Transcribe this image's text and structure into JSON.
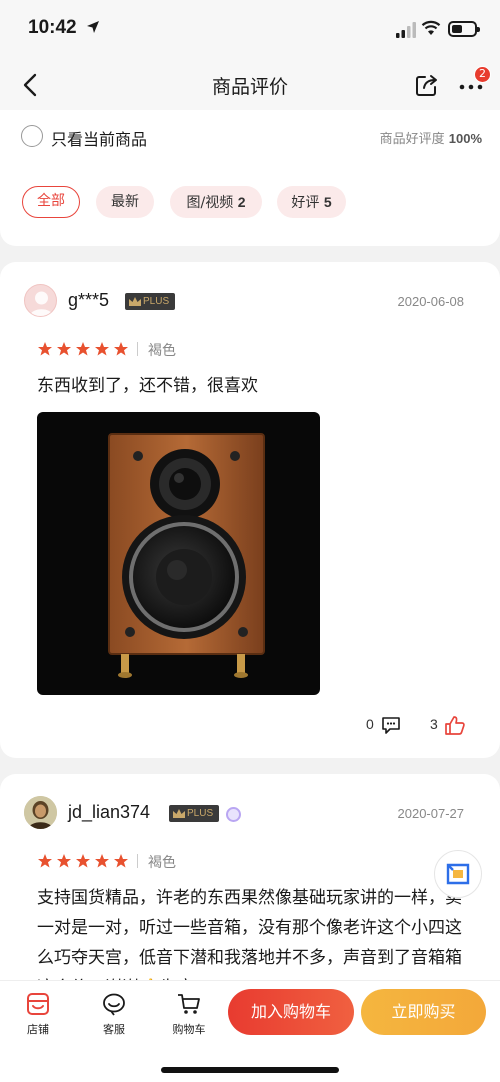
{
  "status_bar": {
    "time": "10:42"
  },
  "nav": {
    "title": "商品评价",
    "more_badge": "2"
  },
  "filter": {
    "only_current": "只看当前商品",
    "rating_label": "商品好评度",
    "rating_value": "100%"
  },
  "tabs": [
    {
      "label": "全部",
      "count": ""
    },
    {
      "label": "最新",
      "count": ""
    },
    {
      "label": "图/视频",
      "count": "2"
    },
    {
      "label": "好评",
      "count": "5"
    }
  ],
  "reviews": [
    {
      "user": "g***5",
      "badge": "PLUS",
      "date": "2020-06-08",
      "stars": 5,
      "variant": "褐色",
      "content": "东西收到了，还不错，很喜欢",
      "comments": "0",
      "likes": "3"
    },
    {
      "user": "jd_lian374",
      "badge": "PLUS",
      "date": "2020-07-27",
      "stars": 5,
      "variant": "褐色",
      "content": "支持国货精品，许老的东西果然像基础玩家讲的一样，卖一对是一对，听过一些音箱，没有那个像老许这个小四这么巧夺天宫，低音下潜和我落地并不多，声音到了音箱箱这个价，谢谢👍为良"
    }
  ],
  "bottom": {
    "shop": "店铺",
    "service": "客服",
    "cart": "购物车",
    "add_cart": "加入购物车",
    "buy_now": "立即购买"
  },
  "colors": {
    "accent": "#e8453c",
    "star": "#e8512f",
    "buy": "#f5b63f"
  }
}
